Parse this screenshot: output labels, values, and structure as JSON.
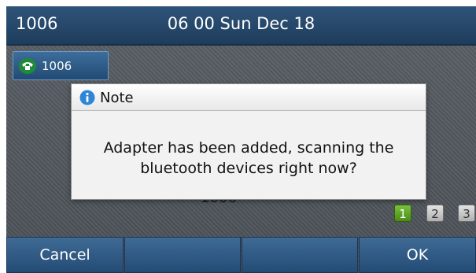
{
  "status_bar": {
    "account": "1006",
    "datetime": "06 00 Sun Dec 18"
  },
  "line_key": {
    "label": "1006"
  },
  "background": {
    "number": "1006"
  },
  "pager": {
    "pages": [
      "1",
      "2",
      "3"
    ],
    "active": "1"
  },
  "dialog": {
    "title": "Note",
    "message_line1": "Adapter has been added, scanning the",
    "message_line2": "bluetooth devices right now?"
  },
  "softkeys": {
    "key1": "Cancel",
    "key2": "",
    "key3": "",
    "key4": "OK"
  },
  "colors": {
    "active_page": "#5fa62a",
    "softkey": "#2f5a86",
    "status_bar": "#25476a"
  }
}
